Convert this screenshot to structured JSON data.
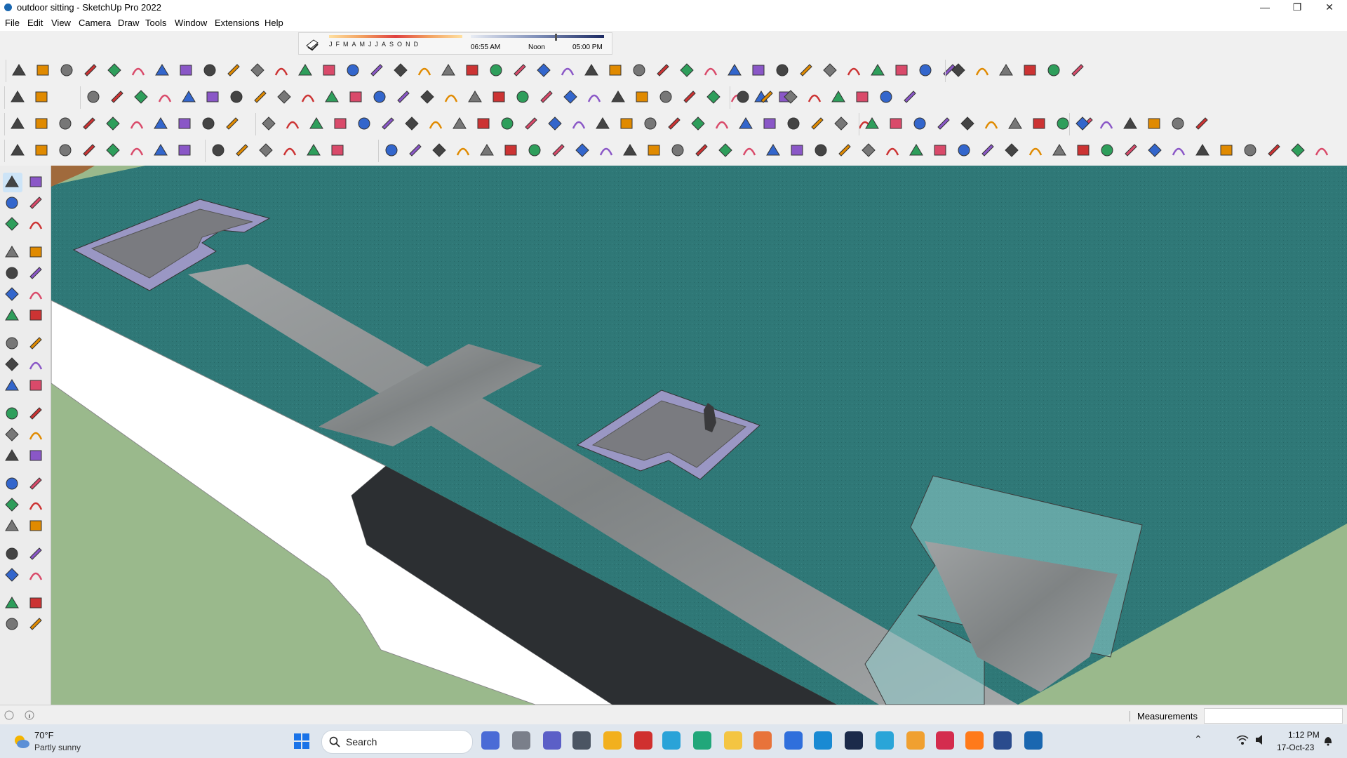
{
  "window": {
    "title": "outdoor sitting - SketchUp Pro 2022"
  },
  "menu": [
    "File",
    "Edit",
    "View",
    "Camera",
    "Draw",
    "Tools",
    "Window",
    "Extensions",
    "Help"
  ],
  "shadows": {
    "months": [
      "J",
      "F",
      "M",
      "A",
      "M",
      "J",
      "J",
      "A",
      "S",
      "O",
      "N",
      "D"
    ],
    "time_start": "06:55 AM",
    "time_mid": "Noon",
    "time_end": "05:00 PM"
  },
  "status": {
    "measurements_label": "Measurements",
    "measurements_value": ""
  },
  "taskbar": {
    "weather_temp": "70°F",
    "weather_desc": "Partly sunny",
    "search_placeholder": "Search",
    "time": "1:12 PM",
    "date": "17-Oct-23"
  },
  "colors": {
    "sky": "#9ab98c",
    "terrace": "#2f7877",
    "paving": "#8d9091",
    "pit_rim": "#9a97c4",
    "wall": "#ffffff",
    "kerb": "#2c2f32"
  }
}
